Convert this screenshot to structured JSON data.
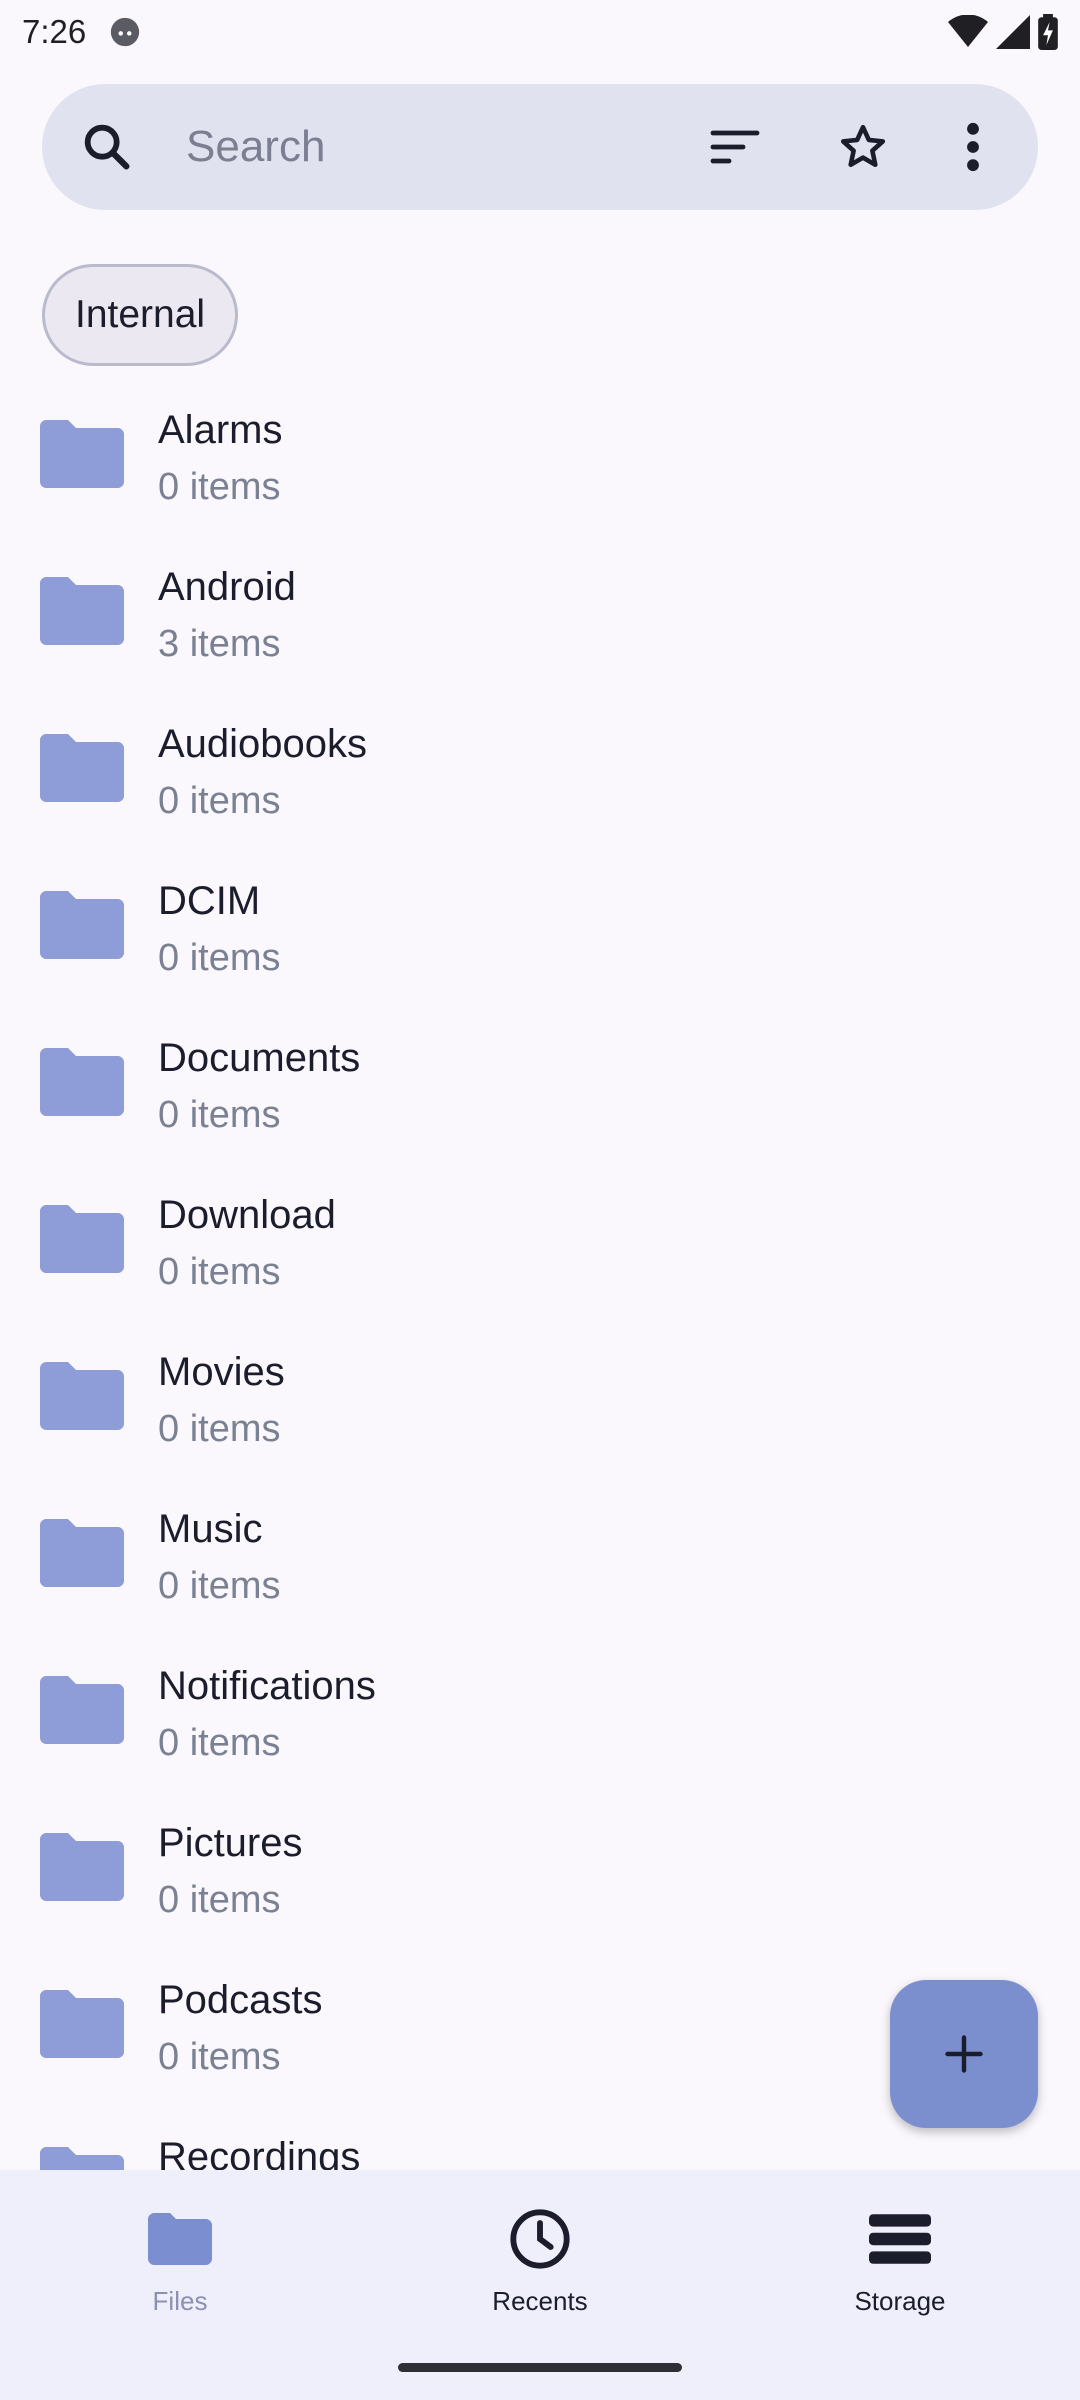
{
  "status_bar": {
    "time": "7:26"
  },
  "search": {
    "placeholder": "Search"
  },
  "chip": {
    "label": "Internal"
  },
  "folders": [
    {
      "name": "Alarms",
      "count": "0 items"
    },
    {
      "name": "Android",
      "count": "3 items"
    },
    {
      "name": "Audiobooks",
      "count": "0 items"
    },
    {
      "name": "DCIM",
      "count": "0 items"
    },
    {
      "name": "Documents",
      "count": "0 items"
    },
    {
      "name": "Download",
      "count": "0 items"
    },
    {
      "name": "Movies",
      "count": "0 items"
    },
    {
      "name": "Music",
      "count": "0 items"
    },
    {
      "name": "Notifications",
      "count": "0 items"
    },
    {
      "name": "Pictures",
      "count": "0 items"
    },
    {
      "name": "Podcasts",
      "count": "0 items"
    },
    {
      "name": "Recordings",
      "count": ""
    }
  ],
  "bottom_nav": {
    "files": "Files",
    "recents": "Recents",
    "storage": "Storage"
  },
  "colors": {
    "folder": "#8E9CD8",
    "fab": "#7B8FCE",
    "search_bg": "#E0E2F0",
    "nav_bg": "#EEEFFA"
  }
}
